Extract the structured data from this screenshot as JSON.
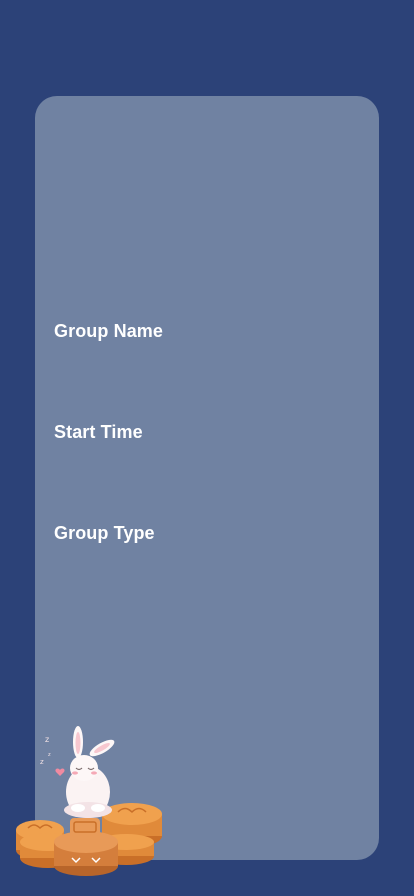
{
  "form": {
    "fields": [
      {
        "label": "Group Name"
      },
      {
        "label": "Start Time"
      },
      {
        "label": "Group Type"
      }
    ]
  },
  "illustration": {
    "icon": "sleeping-rabbit-on-mooncakes-icon"
  },
  "colors": {
    "background": "#2c4278",
    "card": "#7082a2",
    "label_text": "#ffffff",
    "mooncake": "#e08a3a"
  }
}
